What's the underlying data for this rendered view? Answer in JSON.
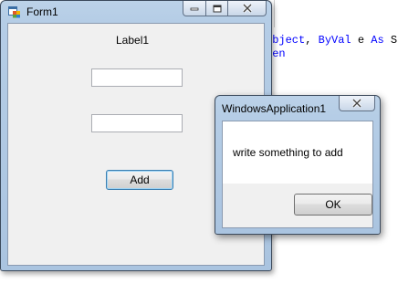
{
  "editor": {
    "line1": {
      "kw": "Object",
      "sep": ", ",
      "kw2": "ByVal",
      "rest": " e ",
      "kw3": "As",
      "tail": " S"
    },
    "line2": {
      "kw": "hen"
    }
  },
  "form1": {
    "title": "Form1",
    "app_icon": "windows-form-icon",
    "label1": "Label1",
    "textbox1_value": "",
    "textbox2_value": "",
    "add_button_label": "Add",
    "caption_icons": [
      "minimize-icon",
      "maximize-icon",
      "close-icon"
    ]
  },
  "messagebox": {
    "title": "WindowsApplication1",
    "message": "write something to add",
    "ok_label": "OK",
    "caption_icons": [
      "close-icon"
    ]
  },
  "colors": {
    "code_keyword": "#0000ff",
    "focus_border": "#3c7fb1",
    "window_frame": "#b5cde6"
  }
}
